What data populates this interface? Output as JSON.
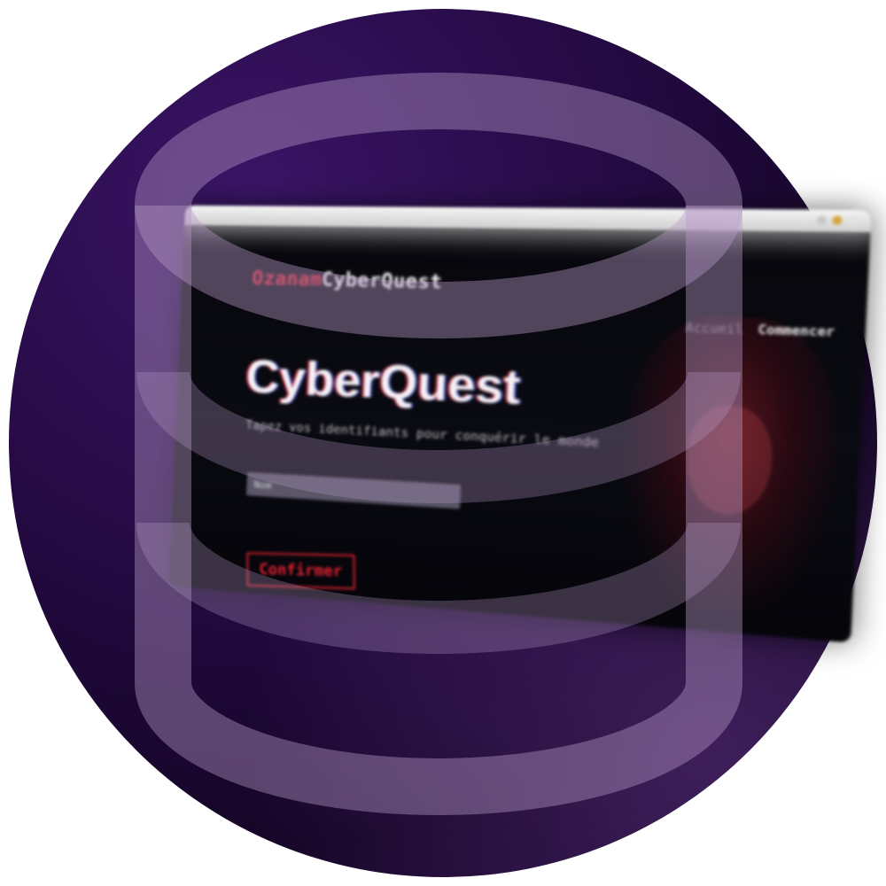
{
  "background": {
    "circle_colors": [
      "#3a1466",
      "#22093f",
      "#150526"
    ]
  },
  "overlay": {
    "icon": "database-icon",
    "color": "#b79ac8"
  },
  "window": {
    "titlebar_dots": [
      "#cfcfcf",
      "#d8a33a",
      "#e0e0e0"
    ],
    "brand": {
      "prefix": "Ozanam",
      "name": "CyberQuest",
      "prefix_color": "#e02633"
    },
    "nav": {
      "items": [
        {
          "label": "Accueil"
        },
        {
          "label": "Commencer"
        }
      ]
    },
    "hero": {
      "title": "CyberQuest",
      "subtitle": "Tapez vos identifiants pour conquérir le monde"
    },
    "form": {
      "input_placeholder": "Nom",
      "confirm_label": "Confirmer"
    },
    "accent": "#d0202c"
  }
}
